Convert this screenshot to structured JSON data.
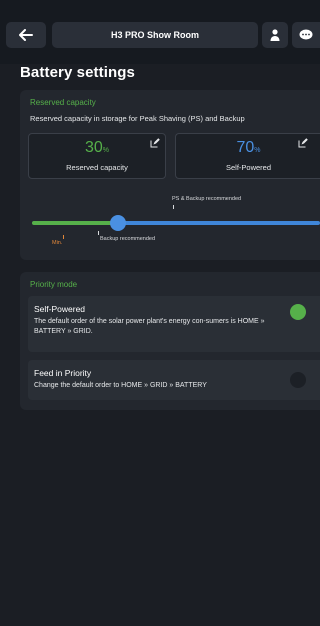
{
  "header": {
    "title": "H3 PRO Show Room",
    "back_icon": "arrow-left-icon",
    "user_icon": "user-icon",
    "chat_icon": "chat-icon"
  },
  "page": {
    "title": "Battery settings"
  },
  "reserved_capacity": {
    "section_title": "Reserved capacity",
    "description": "Reserved capacity in storage for Peak Shaving (PS) and Backup",
    "reserved": {
      "value": "30",
      "unit": "%",
      "label": "Reserved capacity"
    },
    "self_powered": {
      "value": "70",
      "unit": "%",
      "label": "Self-Powered"
    },
    "annotation_ps_backup": "PS & Backup recommended",
    "annotation_min": "Min.",
    "annotation_backup": "Backup recommended",
    "slider_value_percent": 30
  },
  "priority_mode": {
    "section_title": "Priority mode",
    "options": [
      {
        "title": "Self-Powered",
        "description": "The default order of the solar power plant's energy con-sumers is HOME » BATTERY » GRID.",
        "selected": true
      },
      {
        "title": "Feed in Priority",
        "description": "Change the default order to HOME » GRID » BATTERY",
        "selected": false
      }
    ]
  },
  "colors": {
    "accent_green": "#56b04a",
    "accent_blue": "#4a90e2",
    "min_orange": "#e0873a",
    "background": "#1b1e24",
    "card": "#23272e"
  }
}
